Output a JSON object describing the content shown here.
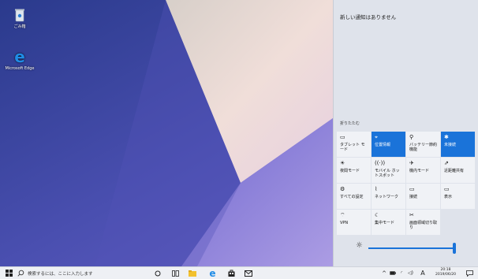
{
  "desktop": {
    "icons": [
      {
        "name": "recycle-bin-icon",
        "label": "ごみ箱"
      },
      {
        "name": "microsoft-edge-icon",
        "label": "Microsoft Edge"
      }
    ]
  },
  "action_center": {
    "no_notifications": "新しい通知はありません",
    "collapse_label": "折りたたむ",
    "tiles": [
      {
        "id": "tablet-mode",
        "label": "タブレット モード",
        "icon": "tablet-icon",
        "active": false
      },
      {
        "id": "location",
        "label": "位置情報",
        "icon": "location-icon",
        "active": true
      },
      {
        "id": "battery-saver",
        "label": "バッテリー節約機能",
        "icon": "battery-saver-icon",
        "active": false
      },
      {
        "id": "bluetooth",
        "label": "未接続",
        "icon": "bluetooth-icon",
        "active": true
      },
      {
        "id": "night-light",
        "label": "夜間モード",
        "icon": "night-light-icon",
        "active": false
      },
      {
        "id": "mobile-hotspot",
        "label": "モバイル ホットスポット",
        "icon": "hotspot-icon",
        "active": false
      },
      {
        "id": "airplane-mode",
        "label": "機内モード",
        "icon": "airplane-icon",
        "active": false
      },
      {
        "id": "nearby-sharing",
        "label": "近距離共有",
        "icon": "share-icon",
        "active": false
      },
      {
        "id": "all-settings",
        "label": "すべての設定",
        "icon": "gear-icon",
        "active": false
      },
      {
        "id": "network",
        "label": "ネットワーク",
        "icon": "network-icon",
        "active": false
      },
      {
        "id": "connect",
        "label": "接続",
        "icon": "connect-icon",
        "active": false
      },
      {
        "id": "project",
        "label": "表示",
        "icon": "project-icon",
        "active": false
      },
      {
        "id": "vpn",
        "label": "VPN",
        "icon": "vpn-icon",
        "active": false
      },
      {
        "id": "focus-assist",
        "label": "集中モード",
        "icon": "moon-icon",
        "active": false
      },
      {
        "id": "screen-snip",
        "label": "画面領域切り取り",
        "icon": "snip-icon",
        "active": false
      }
    ],
    "brightness": 100
  },
  "taskbar": {
    "search_placeholder": "検索するには、ここに入力します",
    "ime_indicator": "A",
    "clock_time": "20:18",
    "clock_date": "2019/06/20"
  },
  "colors": {
    "accent": "#1a73d9",
    "panel": "#dfe3eb",
    "tile": "#f0f2f6",
    "taskbar": "#eef0f4"
  }
}
